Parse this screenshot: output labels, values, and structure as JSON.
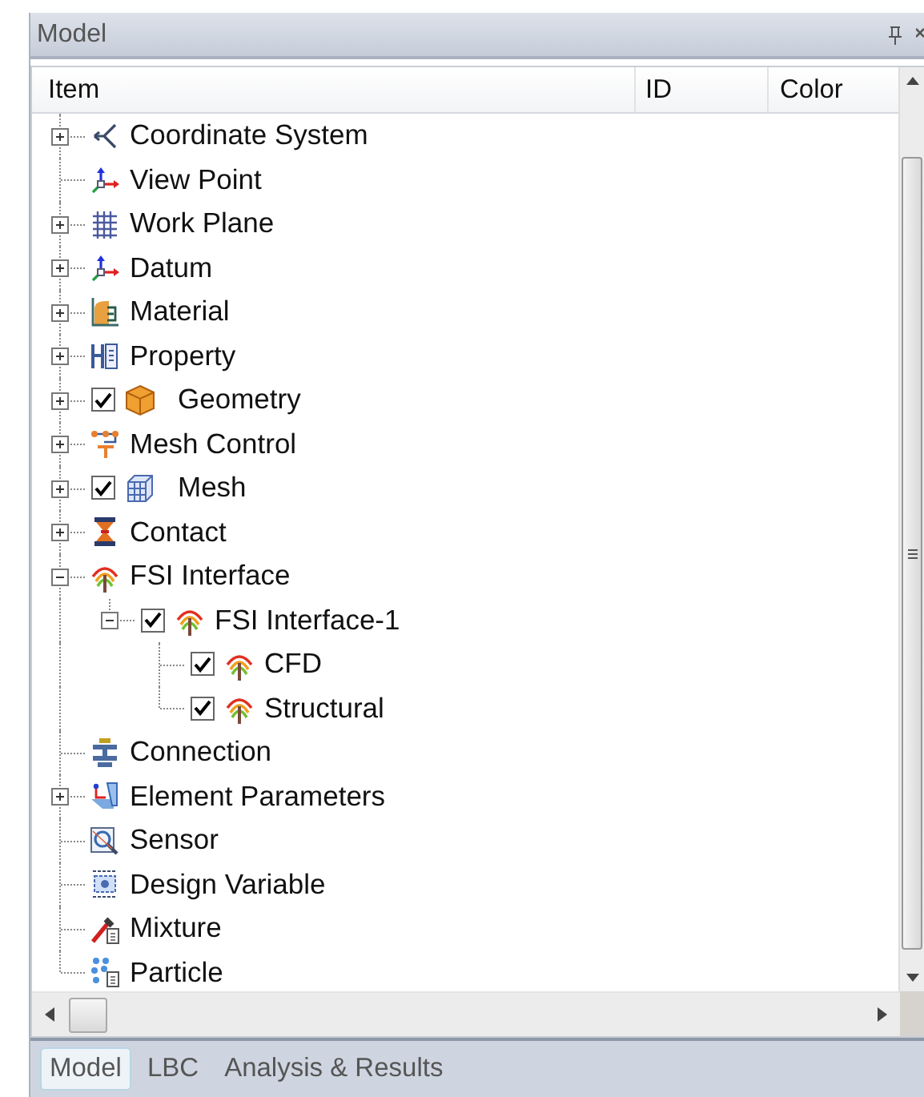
{
  "panel": {
    "title": "Model"
  },
  "columns": [
    "Item",
    "ID",
    "Color"
  ],
  "tree": [
    {
      "label": "Coordinate System",
      "expanded": false
    },
    {
      "label": "View Point"
    },
    {
      "label": "Work Plane",
      "expanded": false
    },
    {
      "label": "Datum",
      "expanded": false
    },
    {
      "label": "Material",
      "expanded": false
    },
    {
      "label": "Property",
      "expanded": false
    },
    {
      "label": "Geometry",
      "expanded": false,
      "checked": true
    },
    {
      "label": "Mesh Control",
      "expanded": false
    },
    {
      "label": "Mesh",
      "expanded": false,
      "checked": true
    },
    {
      "label": "Contact",
      "expanded": false
    },
    {
      "label": "FSI Interface",
      "expanded": true,
      "children": [
        {
          "label": "FSI Interface-1",
          "expanded": true,
          "checked": true,
          "children": [
            {
              "label": "CFD",
              "checked": true
            },
            {
              "label": "Structural",
              "checked": true
            }
          ]
        }
      ]
    },
    {
      "label": "Connection"
    },
    {
      "label": "Element Parameters",
      "expanded": false
    },
    {
      "label": "Sensor"
    },
    {
      "label": "Design Variable"
    },
    {
      "label": "Mixture"
    },
    {
      "label": "Particle"
    }
  ],
  "tabs": [
    {
      "label": "Model",
      "selected": true
    },
    {
      "label": "LBC",
      "selected": false
    },
    {
      "label": "Analysis & Results",
      "selected": false
    }
  ]
}
